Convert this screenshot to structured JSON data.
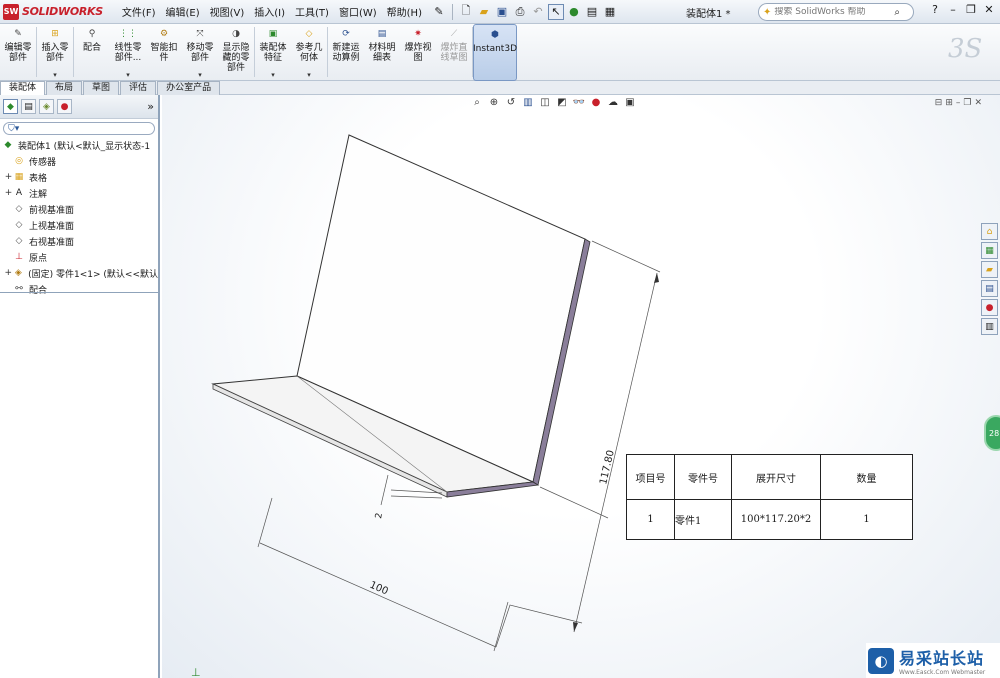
{
  "app": {
    "brand": "SOLIDWORKS",
    "doc_title": "装配体1 *"
  },
  "menu": [
    "文件(F)",
    "编辑(E)",
    "视图(V)",
    "插入(I)",
    "工具(T)",
    "窗口(W)",
    "帮助(H)"
  ],
  "search": {
    "placeholder": "搜索 SolidWorks 帮助"
  },
  "command_manager": {
    "tools": [
      {
        "label": "编辑零\n部件",
        "icon": "edit-component-icon",
        "dropdown": false,
        "disabled": false
      },
      {
        "label": "插入零\n部件",
        "icon": "insert-component-icon",
        "dropdown": true,
        "disabled": false
      },
      {
        "label": "配合",
        "icon": "mate-icon",
        "dropdown": false,
        "disabled": false
      },
      {
        "label": "线性零\n部件...",
        "icon": "linear-pattern-icon",
        "dropdown": true,
        "disabled": false
      },
      {
        "label": "智能扣\n件",
        "icon": "smart-fastener-icon",
        "dropdown": false,
        "disabled": false
      },
      {
        "label": "移动零\n部件",
        "icon": "move-component-icon",
        "dropdown": true,
        "disabled": false
      },
      {
        "label": "显示隐\n藏的零\n部件",
        "icon": "show-hidden-icon",
        "dropdown": false,
        "disabled": false
      },
      {
        "label": "装配体\n特征",
        "icon": "assembly-feature-icon",
        "dropdown": true,
        "disabled": false
      },
      {
        "label": "参考几\n何体",
        "icon": "reference-geometry-icon",
        "dropdown": true,
        "disabled": false
      },
      {
        "label": "新建运\n动算例",
        "icon": "motion-study-icon",
        "dropdown": false,
        "disabled": false
      },
      {
        "label": "材料明\n细表",
        "icon": "bom-icon",
        "dropdown": false,
        "disabled": false
      },
      {
        "label": "爆炸视\n图",
        "icon": "exploded-view-icon",
        "dropdown": false,
        "disabled": false
      },
      {
        "label": "爆炸直\n线草图",
        "icon": "explode-line-icon",
        "dropdown": false,
        "disabled": true
      },
      {
        "label": "Instant3D",
        "icon": "instant3d-icon",
        "dropdown": false,
        "disabled": false,
        "active": true
      }
    ]
  },
  "tabs": [
    "装配体",
    "布局",
    "草图",
    "评估",
    "办公室产品"
  ],
  "feature_tree": {
    "filter_icon": "filter-icon",
    "nodes": [
      {
        "label": "装配体1  (默认<默认_显示状态-1",
        "icon": "assembly-icon",
        "expand": ""
      },
      {
        "label": "传感器",
        "icon": "sensor-icon",
        "expand": ""
      },
      {
        "label": "表格",
        "icon": "table-icon",
        "expand": "+"
      },
      {
        "label": "注解",
        "icon": "annotation-icon",
        "expand": "+"
      },
      {
        "label": "前视基准面",
        "icon": "plane-icon",
        "expand": ""
      },
      {
        "label": "上视基准面",
        "icon": "plane-icon",
        "expand": ""
      },
      {
        "label": "右视基准面",
        "icon": "plane-icon",
        "expand": ""
      },
      {
        "label": "原点",
        "icon": "origin-icon",
        "expand": ""
      },
      {
        "label": "(固定) 零件1<1> (默认<<默认",
        "icon": "part-icon",
        "expand": "+"
      },
      {
        "label": "配合",
        "icon": "mates-icon",
        "expand": ""
      }
    ]
  },
  "drawing": {
    "dim_height": "117.80",
    "dim_width": "100",
    "dim_thickness": "2",
    "part_color": "#ffffff",
    "edge_color": "#8a7e9a"
  },
  "bom_table": {
    "headers": [
      "项目号",
      "零件号",
      "展开尺寸",
      "数量"
    ],
    "rows": [
      [
        "1",
        "零件1",
        "100*117.20*2",
        "1"
      ]
    ]
  },
  "floating_badge": "28",
  "watermark": {
    "title": "易采站长站",
    "subtitle": "Www.Easck.Com  Webmaster"
  }
}
